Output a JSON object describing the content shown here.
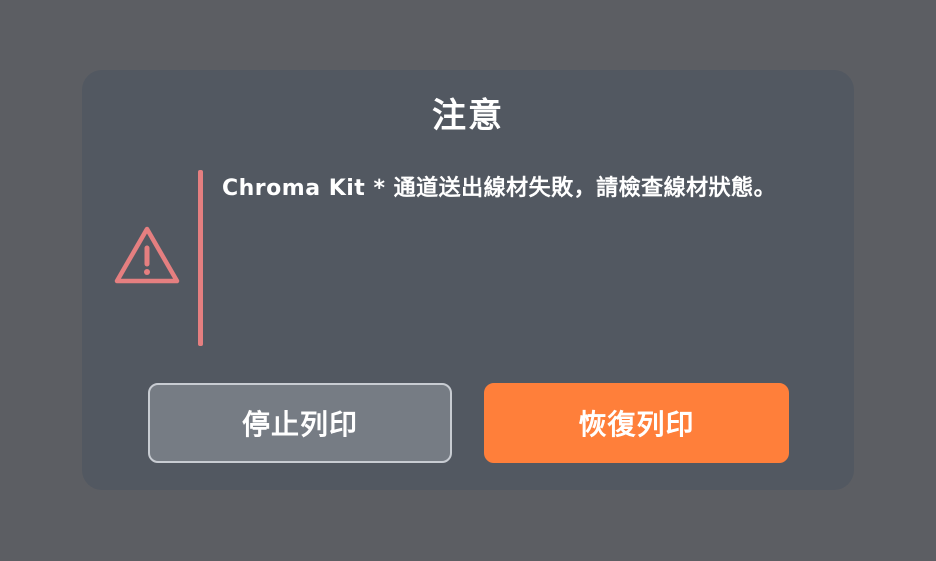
{
  "dialog": {
    "title": "注意",
    "icon": "warning-triangle-icon",
    "message": "Chroma Kit * 通道送出線材失敗，請檢查線材狀態。",
    "colors": {
      "background": "#525861",
      "accent": "#e57f80",
      "primary_button": "#ff7f3a",
      "secondary_button": "#767c84"
    },
    "buttons": {
      "stop_label": "停止列印",
      "resume_label": "恢復列印"
    }
  }
}
